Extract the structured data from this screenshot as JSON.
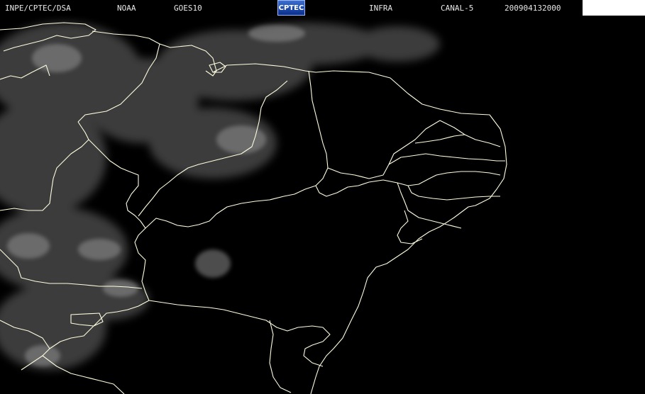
{
  "header": {
    "source": "INPE/CPTEC/DSA",
    "agency": "NOAA",
    "satellite": "GOES10",
    "logo": "CPTEC",
    "product": "INFRA",
    "channel": "CANAL-5",
    "datetime": "200904132000"
  },
  "colors": {
    "background": "#000000",
    "borders": "#fffde0",
    "clouds": "#8a8a8a"
  }
}
